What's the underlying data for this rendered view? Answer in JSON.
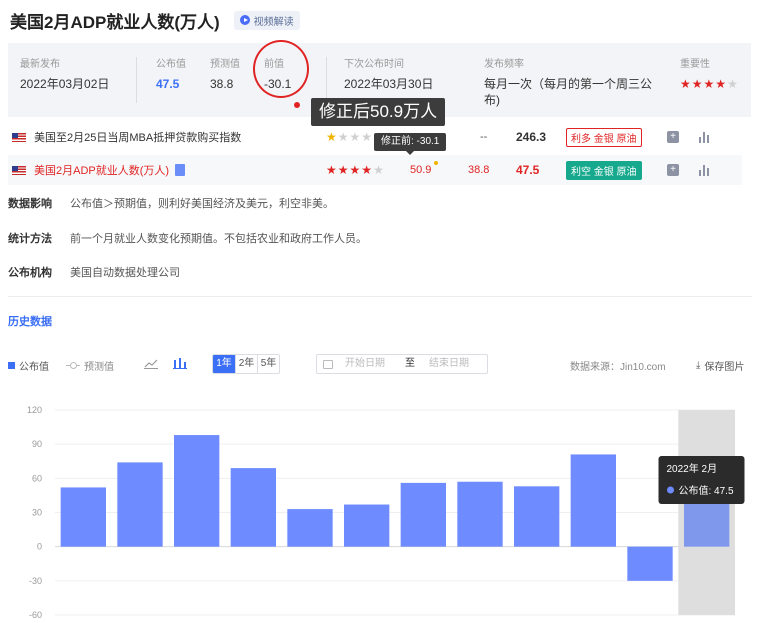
{
  "title": "美国2月ADP就业人数(万人)",
  "video_label": "视频解读",
  "info": {
    "latest_label": "最新发布",
    "latest_value": "2022年03月02日",
    "actual_label": "公布值",
    "actual_value": "47.5",
    "forecast_label": "预测值",
    "forecast_value": "38.8",
    "previous_label": "前值",
    "previous_value": "-30.1",
    "next_label": "下次公布时间",
    "next_value": "2022年03月30日 20:15",
    "freq_label": "发布频率",
    "freq_value": "每月一次（每月的第一个周三公布)",
    "importance_label": "重要性",
    "importance_stars": 4
  },
  "annotations": {
    "revised_tooltip": "修正后50.9万人",
    "before_revision_tooltip": "修正前: -30.1"
  },
  "rows": [
    {
      "name": "美国至2月25日当周MBA抵押贷款购买指数",
      "stars": 1,
      "previous": "",
      "forecast": "--",
      "actual": "246.3",
      "tag": "利多 金银 原油",
      "tag_style": "red"
    },
    {
      "name": "美国2月ADP就业人数(万人)",
      "stars": 4,
      "previous": "50.9",
      "forecast": "38.8",
      "actual": "47.5",
      "tag": "利空 金银 原油",
      "tag_style": "green"
    }
  ],
  "details": [
    {
      "label": "数据影响",
      "text": "公布值＞预期值，则利好美国经济及美元，利空非美。"
    },
    {
      "label": "统计方法",
      "text": "前一个月就业人数变化预期值。不包括农业和政府工作人员。"
    },
    {
      "label": "公布机构",
      "text": "美国自动数据处理公司"
    }
  ],
  "history_title": "历史数据",
  "toolbar": {
    "legend_actual": "公布值",
    "legend_forecast": "预测值",
    "ranges": [
      "1年",
      "2年",
      "5年"
    ],
    "active_range": "1年",
    "start_placeholder": "开始日期",
    "to_label": "至",
    "end_placeholder": "结束日期",
    "source": "数据来源：Jin10.com",
    "save": "保存图片"
  },
  "colors": {
    "accent": "#3b6ff5",
    "bar": "#6e8cff",
    "bar_highlight": "#7f98ec",
    "bearish": "#16a98d",
    "bullish": "#e02424"
  },
  "chart_data": {
    "type": "bar",
    "series": [
      {
        "values": [
          52,
          74,
          98,
          69,
          33,
          37,
          56,
          57,
          53,
          81,
          -30,
          47.5
        ]
      }
    ],
    "ylim": [
      -60,
      120
    ],
    "yticks": [
      120,
      90,
      60,
      30,
      0,
      -30,
      -60
    ],
    "highlight_index": 11,
    "tooltip": {
      "title": "2022年 2月",
      "series_label": "公布值",
      "value": "47.5"
    },
    "grid": true
  }
}
